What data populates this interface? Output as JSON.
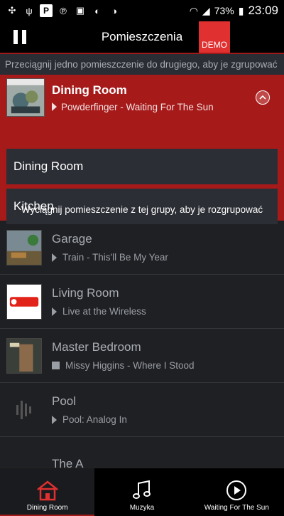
{
  "statusbar": {
    "battery": "73%",
    "time": "23:09"
  },
  "header": {
    "title": "Pomieszczenia",
    "demo_label": "DEMO"
  },
  "hint": "Przeciągnij jedno pomieszczenie do drugiego, aby je zgrupować",
  "group": {
    "name": "Dining Room",
    "track": "Powderfinger - Waiting For The Sun",
    "members": [
      "Dining Room",
      "Kitchen"
    ],
    "ungroup_hint": "Wyciągnij pomieszczenie z tej grupy, aby je rozgrupować"
  },
  "rooms": [
    {
      "name": "Garage",
      "track": "Train - This'll Be My Year",
      "state": "play"
    },
    {
      "name": "Living Room",
      "track": "Live at the Wireless",
      "state": "play"
    },
    {
      "name": "Master Bedroom",
      "track": "Missy Higgins - Where I Stood",
      "state": "stop"
    },
    {
      "name": "Pool",
      "track": "Pool: Analog In",
      "state": "play"
    },
    {
      "name": "The A",
      "track": "",
      "state": ""
    }
  ],
  "tabs": [
    {
      "label": "Dining Room",
      "icon": "house-icon"
    },
    {
      "label": "Muzyka",
      "icon": "music-note-icon"
    },
    {
      "label": "Waiting For The Sun",
      "icon": "play-circle-icon"
    }
  ],
  "colors": {
    "accent": "#a61a1a",
    "demo": "#e03030"
  }
}
